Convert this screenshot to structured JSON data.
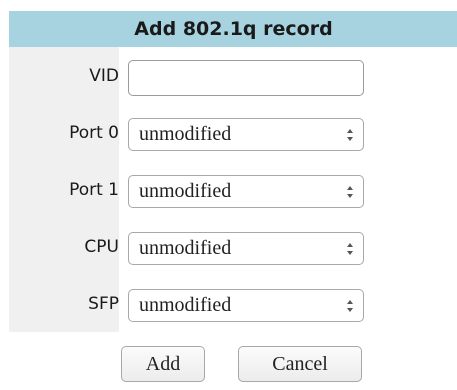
{
  "dialog": {
    "title": "Add 802.1q record",
    "fields": [
      {
        "label": "VID",
        "type": "text",
        "value": ""
      },
      {
        "label": "Port 0",
        "type": "select",
        "value": "unmodified"
      },
      {
        "label": "Port 1",
        "type": "select",
        "value": "unmodified"
      },
      {
        "label": "CPU",
        "type": "select",
        "value": "unmodified"
      },
      {
        "label": "SFP",
        "type": "select",
        "value": "unmodified"
      }
    ],
    "buttons": {
      "add_label": "Add",
      "cancel_label": "Cancel"
    }
  },
  "icons": {
    "select_arrows": "up-down-arrows-icon"
  },
  "colors": {
    "title_background": "#a6d3df",
    "label_column_background": "#f0f0f0"
  }
}
